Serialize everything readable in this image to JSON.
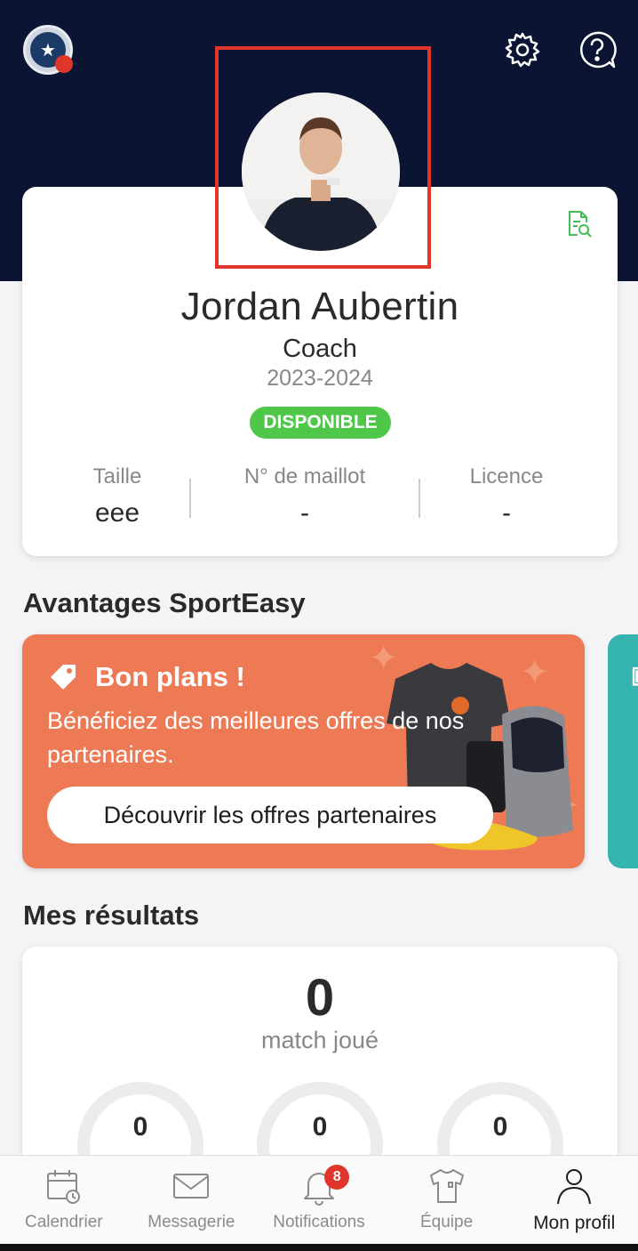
{
  "header": {
    "club_logo_icon": "club-crest-icon",
    "settings_icon": "gear-icon",
    "help_icon": "help-icon"
  },
  "profile": {
    "name": "Jordan Aubertin",
    "role": "Coach",
    "season": "2023-2024",
    "status": "DISPONIBLE",
    "status_color": "#4fc84a",
    "stats": [
      {
        "label": "Taille",
        "value": "eee"
      },
      {
        "label": "N° de maillot",
        "value": "-"
      },
      {
        "label": "Licence",
        "value": "-"
      }
    ]
  },
  "advantages": {
    "section_title": "Avantages SportEasy",
    "promo": {
      "title": "Bon plans !",
      "description": "Bénéficiez des meilleures offres de nos partenaires.",
      "button_label": "Découvrir les offres partenaires",
      "color": "#ee7a55"
    }
  },
  "results": {
    "section_title": "Mes résultats",
    "match_count": "0",
    "match_label": "match joué",
    "rings": [
      "0",
      "0",
      "0"
    ]
  },
  "tabs": [
    {
      "label": "Calendrier",
      "icon": "calendar-icon"
    },
    {
      "label": "Messagerie",
      "icon": "mail-icon"
    },
    {
      "label": "Notifications",
      "icon": "bell-icon",
      "badge": "8"
    },
    {
      "label": "Équipe",
      "icon": "jersey-icon"
    },
    {
      "label": "Mon profil",
      "icon": "user-icon",
      "active": true
    }
  ]
}
